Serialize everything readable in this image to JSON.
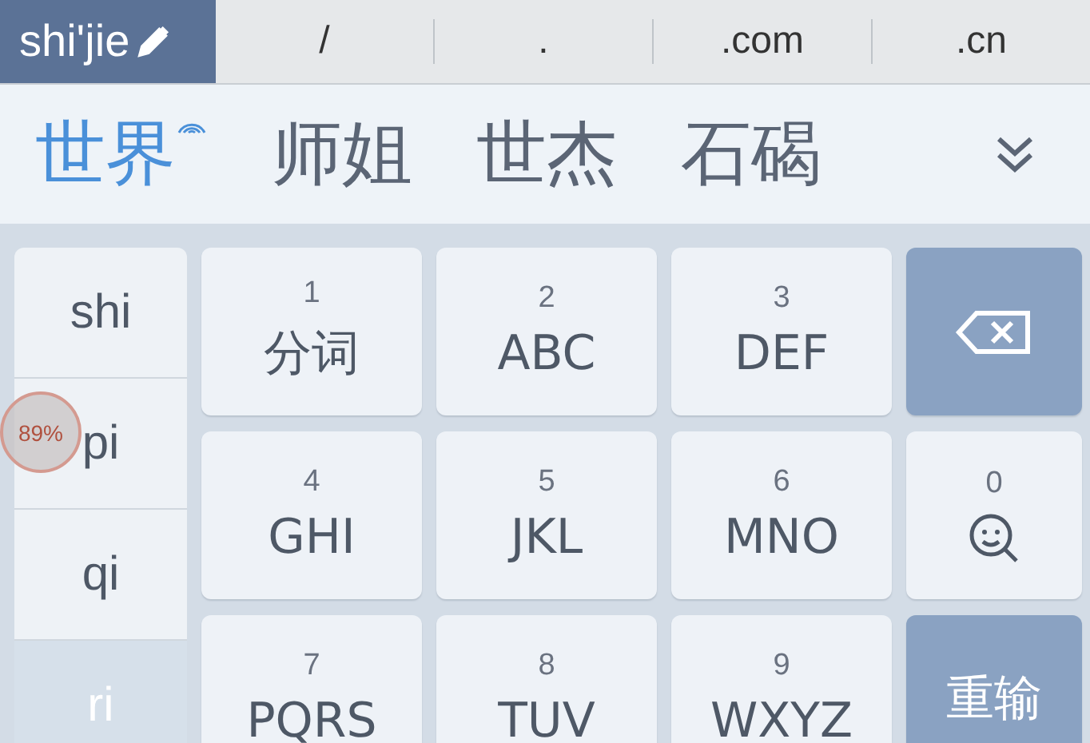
{
  "composition": {
    "text": "shi'jie"
  },
  "shortcuts": [
    "/",
    ".",
    ".com",
    ".cn"
  ],
  "candidates": [
    {
      "text": "世界",
      "selected": true,
      "cloud": true
    },
    {
      "text": "师姐",
      "selected": false,
      "cloud": false
    },
    {
      "text": "世杰",
      "selected": false,
      "cloud": false
    },
    {
      "text": "石碣",
      "selected": false,
      "cloud": false
    }
  ],
  "pinyin": [
    {
      "text": "shi",
      "selected": false
    },
    {
      "text": "pi",
      "selected": false
    },
    {
      "text": "qi",
      "selected": false
    },
    {
      "text": "ri",
      "selected": true
    }
  ],
  "keys": [
    {
      "kind": "letter",
      "digit": "1",
      "label": "分词"
    },
    {
      "kind": "letter",
      "digit": "2",
      "label": "ABC"
    },
    {
      "kind": "letter",
      "digit": "3",
      "label": "DEF"
    },
    {
      "kind": "backspace"
    },
    {
      "kind": "letter",
      "digit": "4",
      "label": "GHI"
    },
    {
      "kind": "letter",
      "digit": "5",
      "label": "JKL"
    },
    {
      "kind": "letter",
      "digit": "6",
      "label": "MNO"
    },
    {
      "kind": "emoji",
      "digit": "0"
    },
    {
      "kind": "letter",
      "digit": "7",
      "label": "PQRS"
    },
    {
      "kind": "letter",
      "digit": "8",
      "label": "TUV"
    },
    {
      "kind": "letter",
      "digit": "9",
      "label": "WXYZ"
    },
    {
      "kind": "action",
      "label": "重输"
    }
  ],
  "floating_badge": {
    "text": "89%"
  }
}
